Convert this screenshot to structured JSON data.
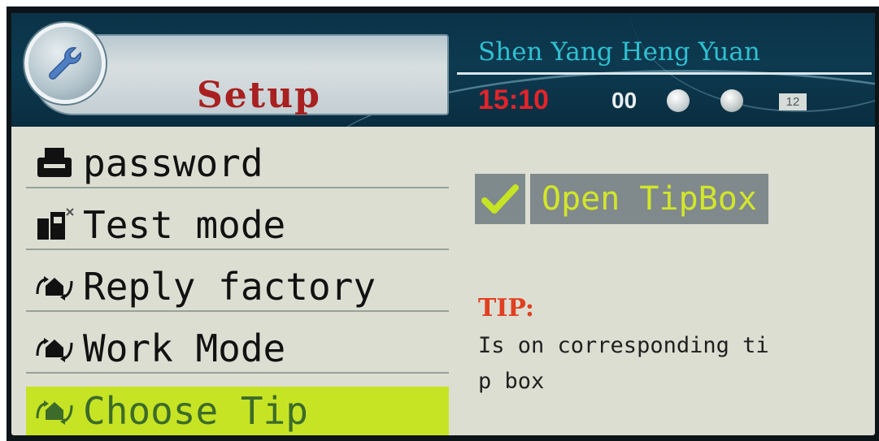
{
  "header": {
    "title": "Setup",
    "brand": "Shen Yang Heng Yuan",
    "time": "15:10",
    "counter": "00",
    "status_box": "12",
    "icons": [
      "wrench-icon",
      "globe-icon",
      "face-icon"
    ]
  },
  "menu": {
    "items": [
      {
        "label": "password",
        "icon": "printer-icon"
      },
      {
        "label": "Test mode",
        "icon": "test-device-icon"
      },
      {
        "label": "Reply factory",
        "icon": "home-arrows-icon"
      },
      {
        "label": "Work Mode",
        "icon": "home-arrows-icon"
      },
      {
        "label": "Choose Tip",
        "icon": "home-arrows-icon"
      }
    ],
    "selected_index": 4
  },
  "tipbox": {
    "checked": true,
    "label": "Open TipBox"
  },
  "tip": {
    "heading": "TIP:",
    "line1": "Is on corresponding ti",
    "line2": "p box"
  },
  "colors": {
    "header_bg": "#0b3247",
    "brand_text": "#2fc0d0",
    "time_text": "#e2242a",
    "selected_bg": "#c6e424",
    "tipbox_text": "#d2e62a",
    "tip_heading": "#e04020"
  }
}
